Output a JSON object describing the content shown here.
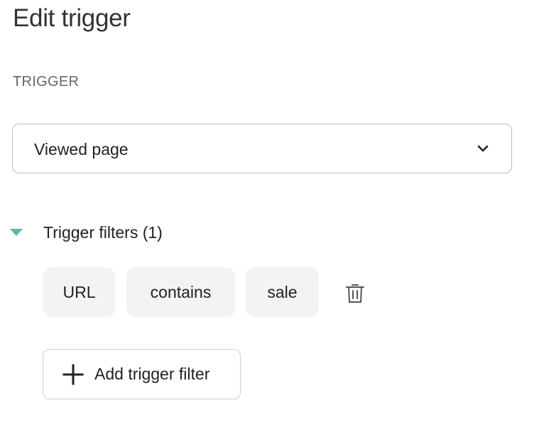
{
  "header": {
    "title": "Edit trigger"
  },
  "trigger": {
    "section_label": "TRIGGER",
    "selected": "Viewed page",
    "icon": "chevron-down-icon"
  },
  "filters": {
    "label": "Trigger filters (1)",
    "expanded": true,
    "toggle_icon": "caret-down-icon",
    "accent_color": "#5fb3ad",
    "items": [
      {
        "field": "URL",
        "operator": "contains",
        "value": "sale",
        "delete_icon": "trash-icon"
      }
    ],
    "add_label": "Add trigger filter",
    "add_icon": "plus-icon"
  }
}
